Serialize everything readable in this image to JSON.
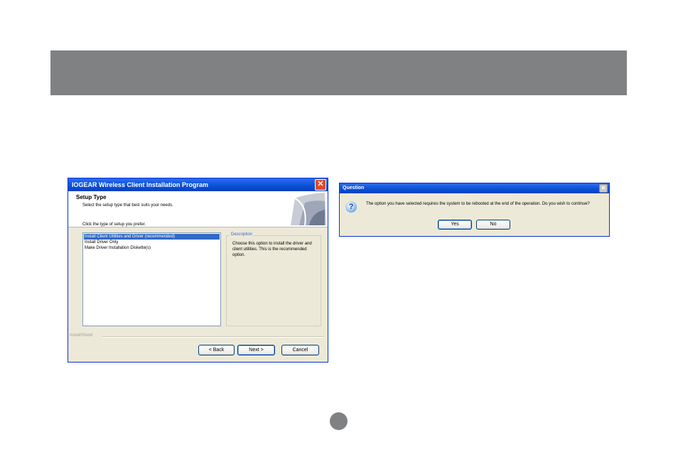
{
  "installer": {
    "title": "IOGEAR Wireless Client Installation Program",
    "close_glyph": "✕",
    "heading": "Setup Type",
    "subheading": "Select the setup type that best suits your needs.",
    "prompt": "Click the type of setup you prefer.",
    "options": [
      "Install Client Utilities and Driver (recommended)",
      "Install Driver Only",
      "Make Driver Installation Diskette(s)"
    ],
    "selected_index": 0,
    "description_label": "Description",
    "description_text": "Choose this option to install the driver and client utilities. This is the recommended option.",
    "brand": "InstallShield",
    "back_label": "< Back",
    "next_label": "Next >",
    "cancel_label": "Cancel"
  },
  "question": {
    "title": "Question",
    "close_glyph": "✕",
    "icon": "question-icon",
    "icon_glyph": "?",
    "message": "The option you have selected requires the system to be rebooted at the end of the operation. Do you wish to continue?",
    "yes_label": "Yes",
    "no_label": "No"
  },
  "colors": {
    "header_bar": "#7f8183",
    "titlebar": "#0a4fd4",
    "selection": "#316ac5"
  }
}
